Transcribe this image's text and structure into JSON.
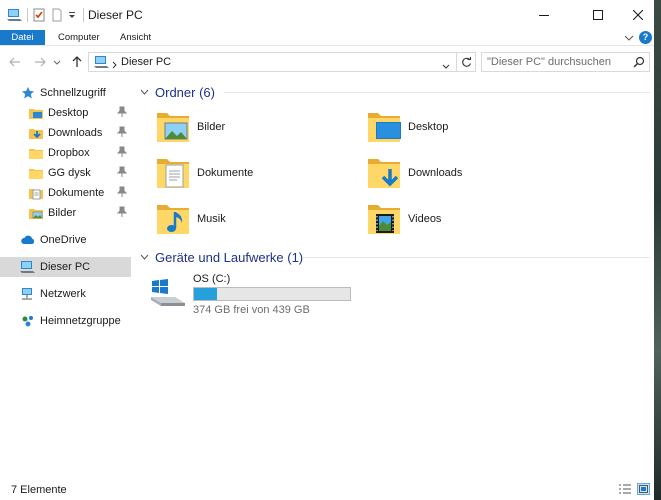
{
  "window": {
    "title": "Dieser PC",
    "accent": "#1979ca"
  },
  "ribbon": {
    "tabs": [
      {
        "label": "Datei",
        "active": true
      },
      {
        "label": "Computer"
      },
      {
        "label": "Ansicht"
      }
    ]
  },
  "address": {
    "path": "Dieser PC",
    "search_placeholder": "\"Dieser PC\" durchsuchen"
  },
  "sidebar": {
    "quick_access": "Schnellzugriff",
    "pinned": [
      {
        "label": "Desktop",
        "icon": "desktop-folder-icon",
        "pinned": true
      },
      {
        "label": "Downloads",
        "icon": "downloads-folder-icon",
        "pinned": true
      },
      {
        "label": "Dropbox",
        "icon": "folder-icon",
        "pinned": true
      },
      {
        "label": "GG dysk",
        "icon": "folder-icon",
        "pinned": true
      },
      {
        "label": "Dokumente",
        "icon": "documents-folder-icon",
        "pinned": true
      },
      {
        "label": "Bilder",
        "icon": "pictures-folder-icon",
        "pinned": true
      }
    ],
    "onedrive": "OneDrive",
    "this_pc": "Dieser PC",
    "network": "Netzwerk",
    "homegroup": "Heimnetzgruppe"
  },
  "content": {
    "folders_header": "Ordner (6)",
    "folders": [
      {
        "label": "Bilder",
        "icon": "pictures-folder-icon"
      },
      {
        "label": "Desktop",
        "icon": "desktop-folder-icon"
      },
      {
        "label": "Dokumente",
        "icon": "documents-folder-icon"
      },
      {
        "label": "Downloads",
        "icon": "downloads-folder-icon"
      },
      {
        "label": "Musik",
        "icon": "music-folder-icon"
      },
      {
        "label": "Videos",
        "icon": "videos-folder-icon"
      }
    ],
    "drives_header": "Geräte und Laufwerke (1)",
    "drive": {
      "name": "OS (C:)",
      "free_text": "374 GB frei von 439 GB",
      "used_fraction": 0.148
    }
  },
  "status": {
    "item_count": "7 Elemente"
  }
}
